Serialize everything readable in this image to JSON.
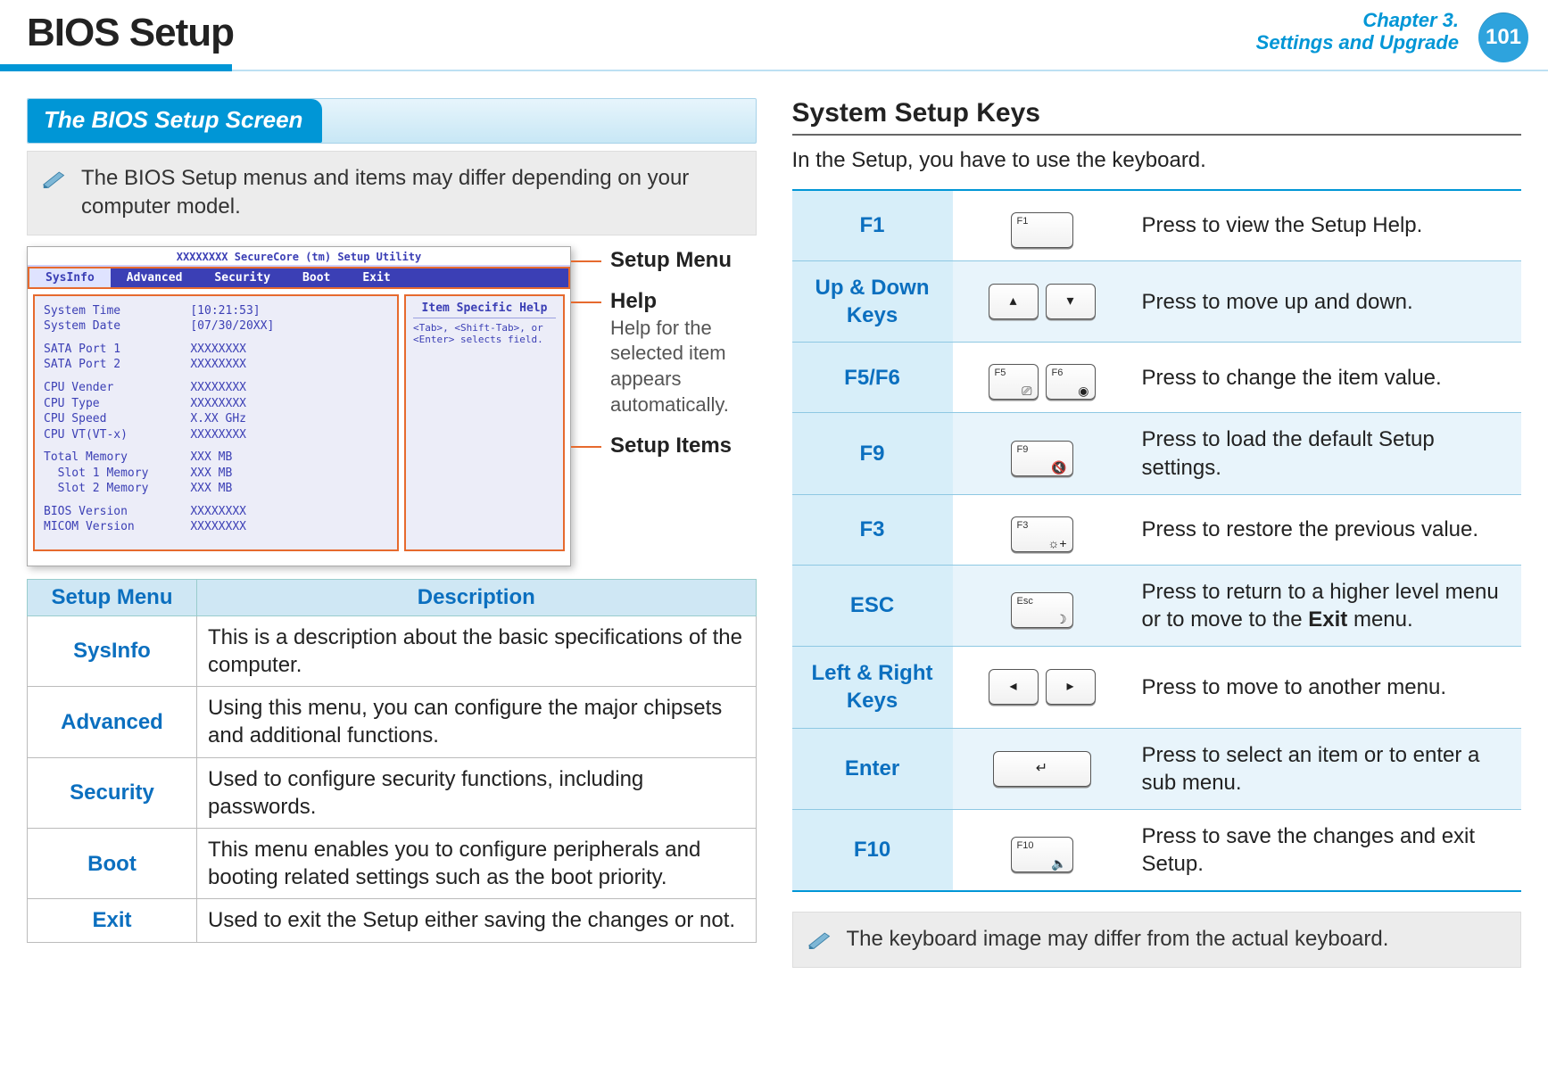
{
  "header": {
    "title": "BIOS Setup",
    "chapter_line1": "Chapter 3.",
    "chapter_line2": "Settings and Upgrade",
    "page": "101"
  },
  "left": {
    "section_tab": "The BIOS Setup Screen",
    "note": "The BIOS Setup menus and items may differ depending on your computer model.",
    "bios": {
      "title": "XXXXXXXX SecureCore (tm) Setup Utility",
      "menu": [
        "SysInfo",
        "Advanced",
        "Security",
        "Boot",
        "Exit"
      ],
      "active_menu": "SysInfo",
      "sysinfo": {
        "g1": "System Time          [10:21:53]\nSystem Date          [07/30/20XX]",
        "g2": "SATA Port 1          XXXXXXXX\nSATA Port 2          XXXXXXXX",
        "g3": "CPU Vender           XXXXXXXX\nCPU Type             XXXXXXXX\nCPU Speed            X.XX GHz\nCPU VT(VT-x)         XXXXXXXX",
        "g4": "Total Memory         XXX MB\n  Slot 1 Memory      XXX MB\n  Slot 2 Memory      XXX MB",
        "g5": "BIOS Version         XXXXXXXX\nMICOM Version        XXXXXXXX"
      },
      "help_title": "Item Specific Help",
      "help_text": "<Tab>, <Shift-Tab>, or <Enter> selects field."
    },
    "callouts": {
      "c1_title": "Setup Menu",
      "c2_title": "Help",
      "c2_sub": "Help for the selected item appears automatically.",
      "c3_title": "Setup Items"
    },
    "menu_table": {
      "headers": [
        "Setup Menu",
        "Description"
      ],
      "rows": [
        {
          "name": "SysInfo",
          "desc": "This is a description about the basic specifications of the computer."
        },
        {
          "name": "Advanced",
          "desc": "Using this menu, you can configure the major chipsets and additional functions."
        },
        {
          "name": "Security",
          "desc": "Used to configure security functions, including passwords."
        },
        {
          "name": "Boot",
          "desc": "This menu enables you to configure peripherals and booting related settings such as the boot priority."
        },
        {
          "name": "Exit",
          "desc": "Used to exit the Setup either saving the changes or not."
        }
      ]
    }
  },
  "right": {
    "heading": "System Setup Keys",
    "intro": "In the Setup, you have to use the keyboard.",
    "keys": [
      {
        "name": "F1",
        "icons": [
          {
            "label": "F1",
            "glyph": ""
          }
        ],
        "desc": "Press to view the Setup Help."
      },
      {
        "name": "Up & Down Keys",
        "icons": [
          {
            "label": "",
            "glyph": "▴",
            "cls": "narrow center"
          },
          {
            "label": "",
            "glyph": "▾",
            "cls": "narrow center"
          }
        ],
        "desc": "Press to move up and down."
      },
      {
        "name": "F5/F6",
        "icons": [
          {
            "label": "F5",
            "glyph": "⎚",
            "cls": "narrow"
          },
          {
            "label": "F6",
            "glyph": "◉",
            "cls": "narrow"
          }
        ],
        "desc": "Press to change the item value."
      },
      {
        "name": "F9",
        "icons": [
          {
            "label": "F9",
            "glyph": "🔇"
          }
        ],
        "desc": "Press to load the default Setup settings."
      },
      {
        "name": "F3",
        "icons": [
          {
            "label": "F3",
            "glyph": "☼+"
          }
        ],
        "desc": "Press to restore the previous value."
      },
      {
        "name": "ESC",
        "icons": [
          {
            "label": "Esc",
            "glyph": "☽"
          }
        ],
        "desc_html": "Press to return to a higher level menu or to move to the <b>Exit</b> menu."
      },
      {
        "name": "Left & Right Keys",
        "icons": [
          {
            "label": "",
            "glyph": "◂",
            "cls": "narrow center"
          },
          {
            "label": "",
            "glyph": "▸",
            "cls": "narrow center"
          }
        ],
        "desc": "Press to move to another menu."
      },
      {
        "name": "Enter",
        "icons": [
          {
            "label": "",
            "glyph": "↵",
            "cls": "wide center"
          }
        ],
        "desc": "Press to select an item or to enter a sub menu."
      },
      {
        "name": "F10",
        "icons": [
          {
            "label": "F10",
            "glyph": "🔈"
          }
        ],
        "desc": "Press to save the changes and exit Setup."
      }
    ],
    "note": "The keyboard image may differ from the actual keyboard."
  }
}
